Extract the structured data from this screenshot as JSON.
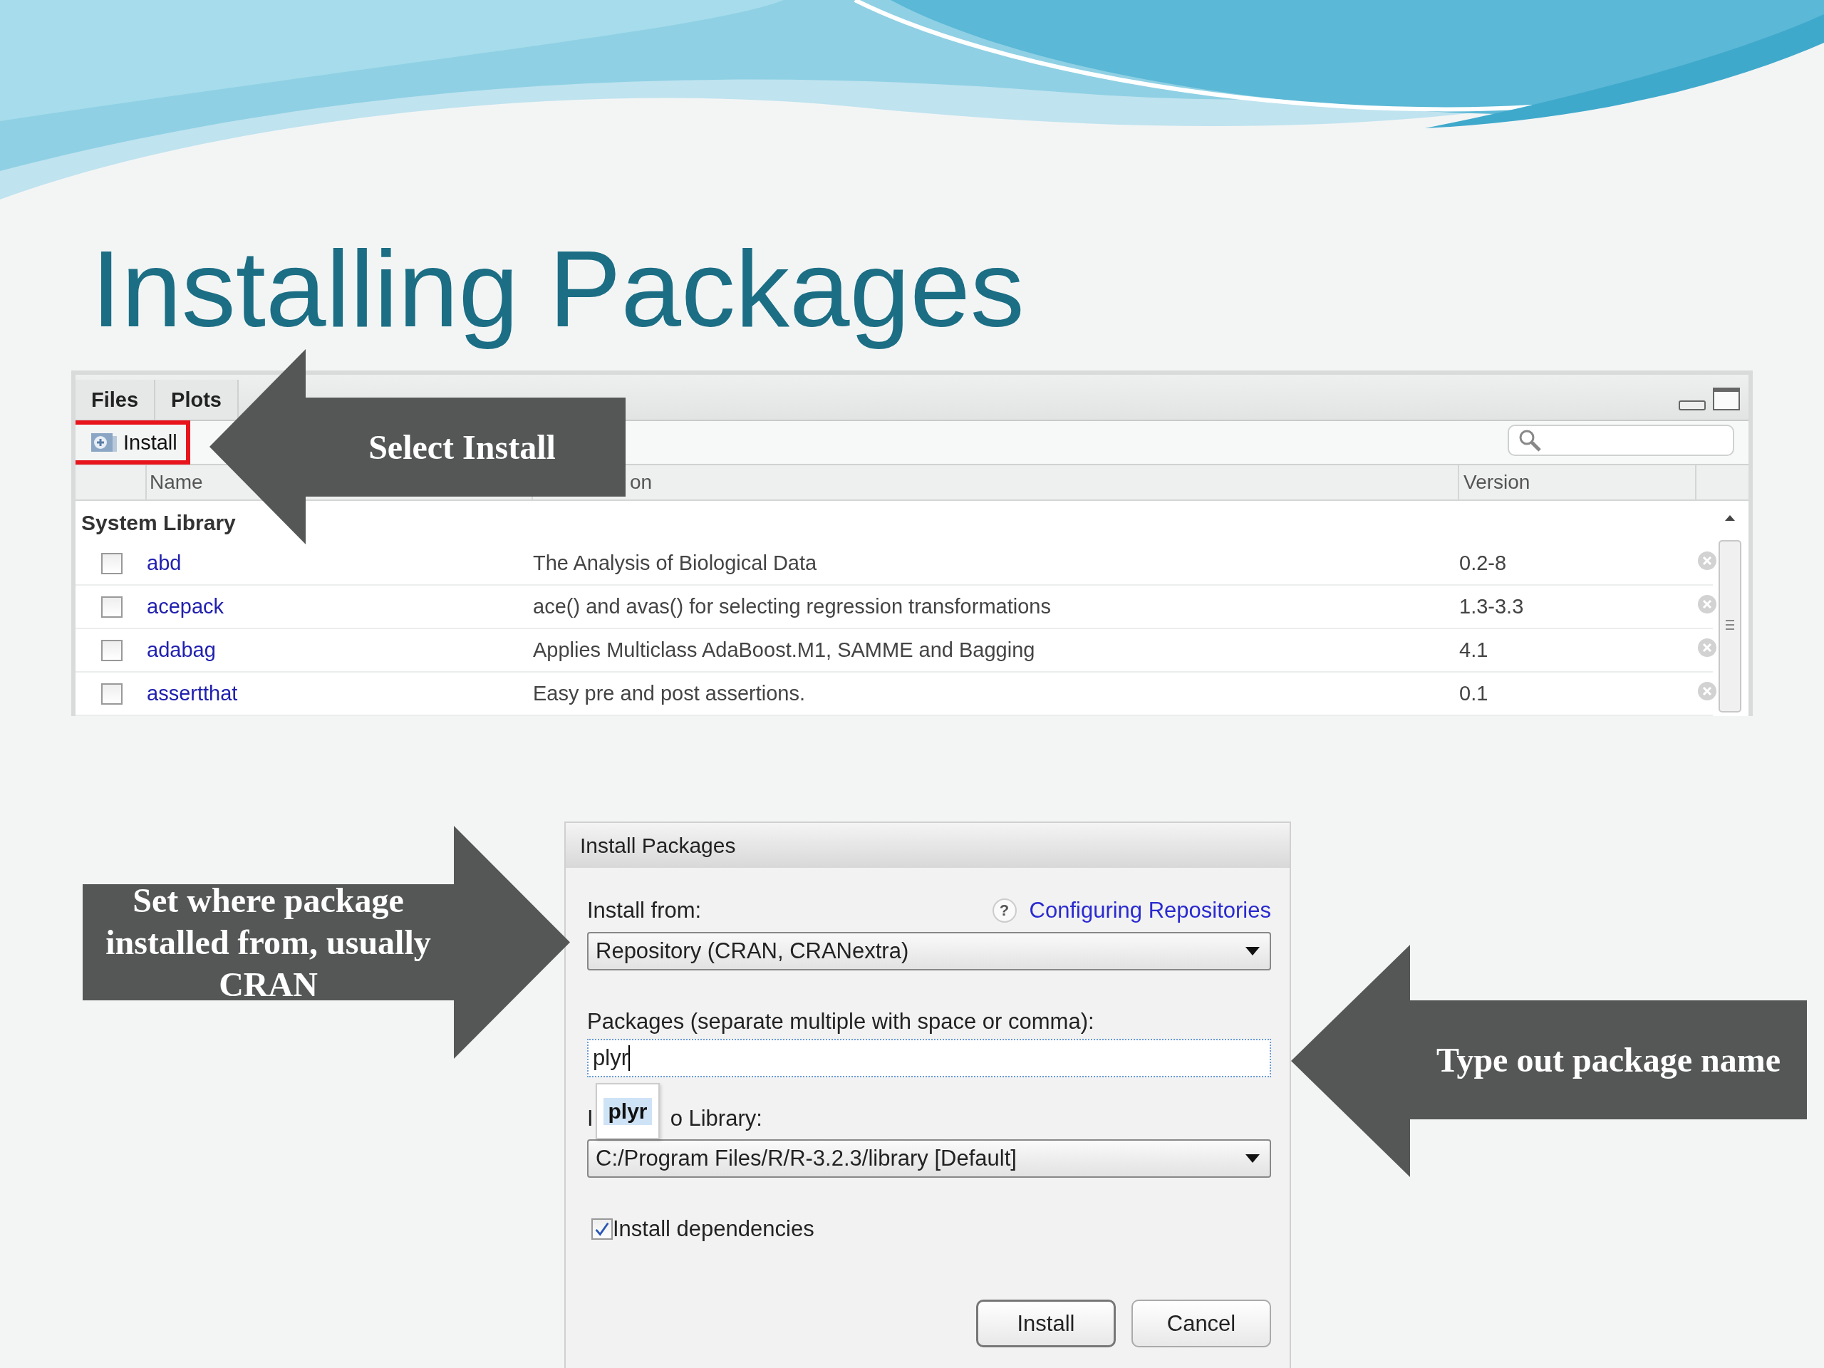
{
  "slide": {
    "title": "Installing Packages"
  },
  "packages_pane": {
    "tabs": [
      {
        "label": "Files",
        "selected": false
      },
      {
        "label": "Plots",
        "selected": false
      }
    ],
    "install_button": "Install",
    "columns": [
      "Name",
      "on",
      "Version"
    ],
    "group": "System Library",
    "rows": [
      {
        "checked": false,
        "name": "abd",
        "description": "The Analysis of Biological Data",
        "version": "0.2-8"
      },
      {
        "checked": false,
        "name": "acepack",
        "description": "ace() and avas() for selecting regression transformations",
        "version": "1.3-3.3"
      },
      {
        "checked": false,
        "name": "adabag",
        "description": "Applies Multiclass AdaBoost.M1, SAMME and Bagging",
        "version": "4.1"
      },
      {
        "checked": false,
        "name": "assertthat",
        "description": "Easy pre and post assertions.",
        "version": "0.1"
      }
    ]
  },
  "dialog": {
    "title": "Install Packages",
    "install_from_label": "Install from:",
    "help_link": "Configuring Repositories",
    "help_icon": "?",
    "install_from_value": "Repository (CRAN, CRANextra)",
    "packages_label": "Packages (separate multiple with space or comma):",
    "packages_value": "plyr",
    "suggestions": [
      {
        "label": "plyr",
        "selected": true
      }
    ],
    "library_label_parts": [
      "I",
      "o Library:"
    ],
    "library_value": "C:/Program Files/R/R-3.2.3/library [Default]",
    "dependencies": {
      "label": "Install dependencies",
      "checked": true
    },
    "buttons": [
      {
        "label": "Install",
        "kind": "default"
      },
      {
        "label": "Cancel",
        "kind": "normal"
      }
    ]
  },
  "callouts": [
    {
      "text": "Select Install",
      "kind": "left"
    },
    {
      "text": "Set where package installed from, usually CRAN",
      "kind": "right"
    },
    {
      "text": "Type out package name",
      "kind": "left"
    }
  ]
}
